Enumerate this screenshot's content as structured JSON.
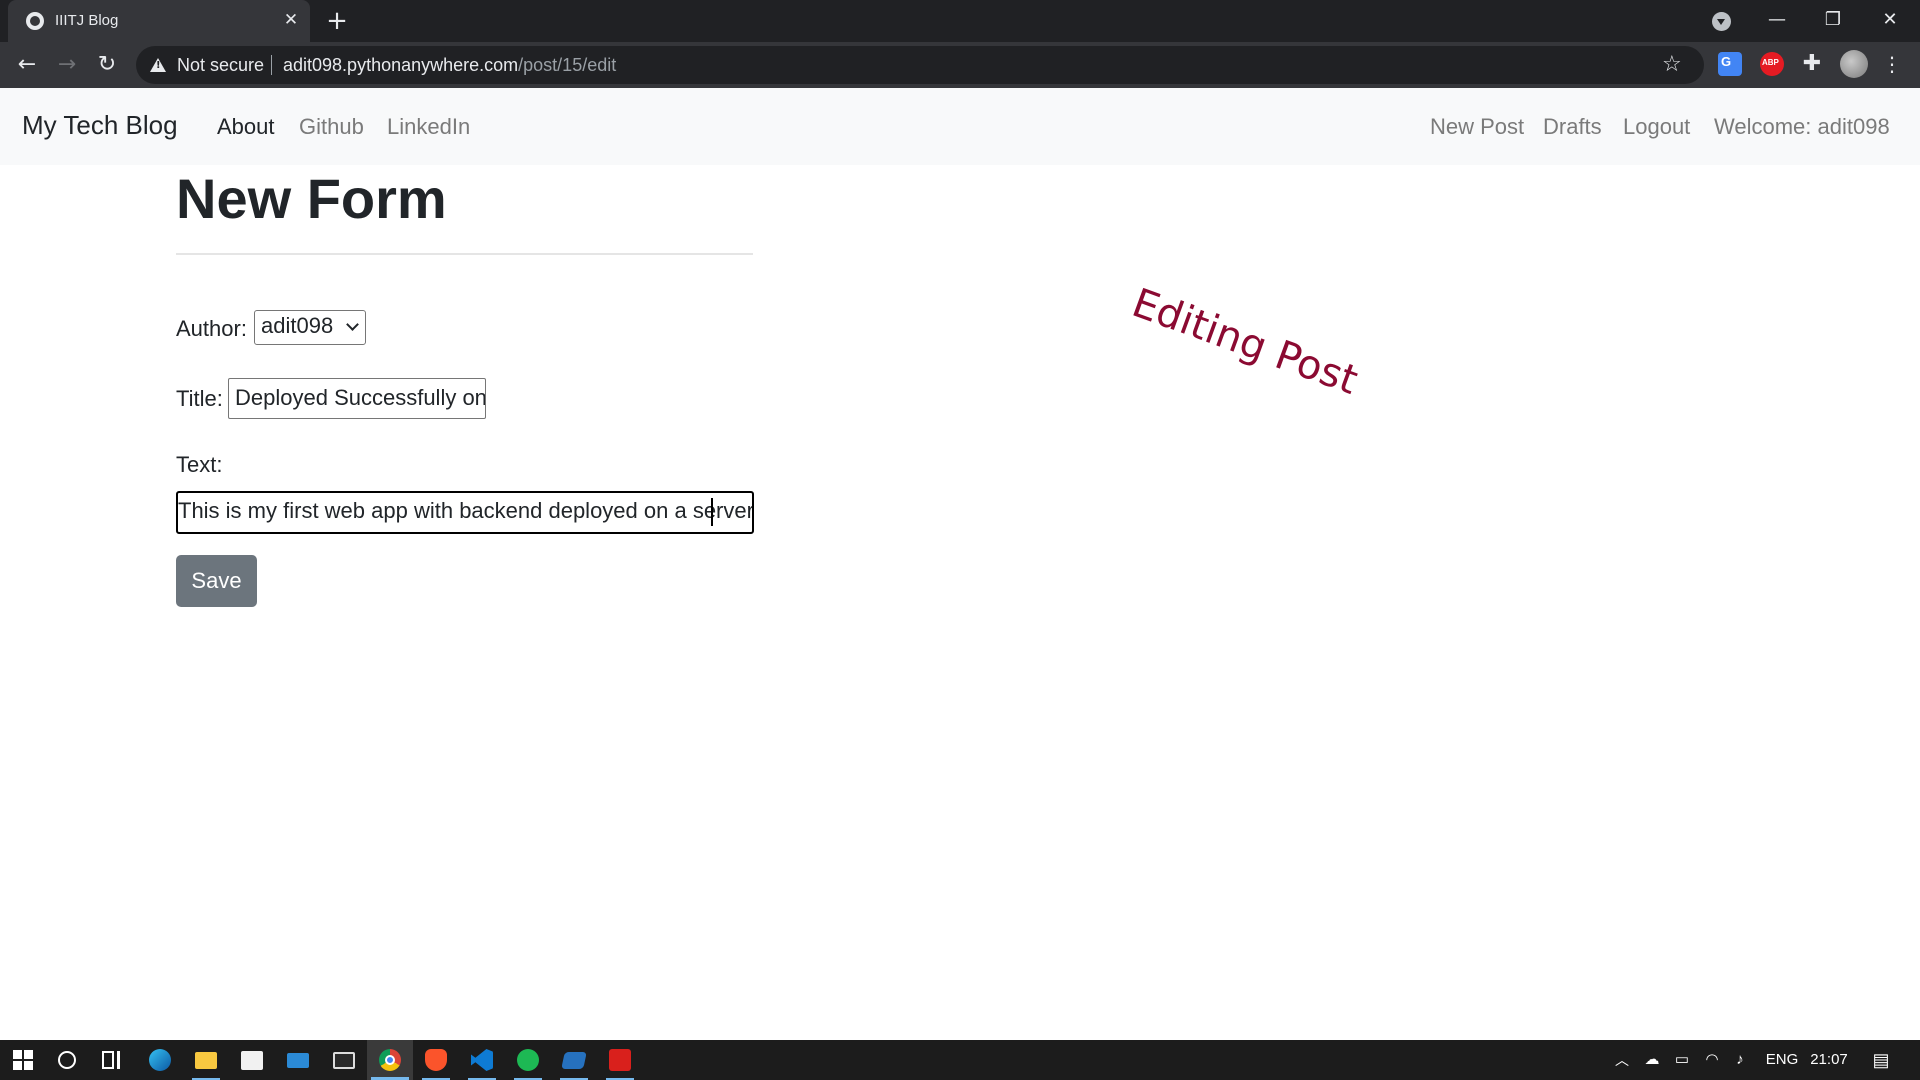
{
  "browser": {
    "tab_title": "IIITJ Blog",
    "tab_close": "✕",
    "new_tab": "+",
    "window_minimize": "—",
    "window_restore": "❐",
    "window_close": "✕",
    "back": "←",
    "forward": "→",
    "reload": "↻",
    "security_label": "Not secure",
    "url_host": "adit098.pythonanywhere.com",
    "url_path": "/post/15/edit",
    "bookmark_star": "☆",
    "extensions_icon": "✚",
    "menu": "⋮"
  },
  "site": {
    "brand": "My Tech Blog",
    "nav_left": [
      "About",
      "Github",
      "LinkedIn"
    ],
    "nav_right": [
      "New Post",
      "Drafts",
      "Logout",
      "Welcome: adit098"
    ]
  },
  "form": {
    "heading": "New Form",
    "stamp": "Editing Post",
    "author_label": "Author:",
    "author_value": "adit098",
    "title_label": "Title:",
    "title_value": "Deployed Successfully on",
    "text_label": "Text:",
    "text_value": "This is my first web app with backend deployed on a server.",
    "save_label": "Save"
  },
  "taskbar": {
    "apps": [
      "start-button",
      "cortana-search",
      "task-view",
      "edge",
      "file-explorer",
      "microsoft-store",
      "mail",
      "terminal",
      "chrome",
      "brave",
      "vscode",
      "spotify",
      "powershell",
      "acrobat"
    ],
    "language": "ENG",
    "time": "21:07"
  },
  "colors": {
    "stamp": "#8b0a32",
    "save_button": "#6c757d",
    "nav_bg": "#f8f9fa"
  }
}
